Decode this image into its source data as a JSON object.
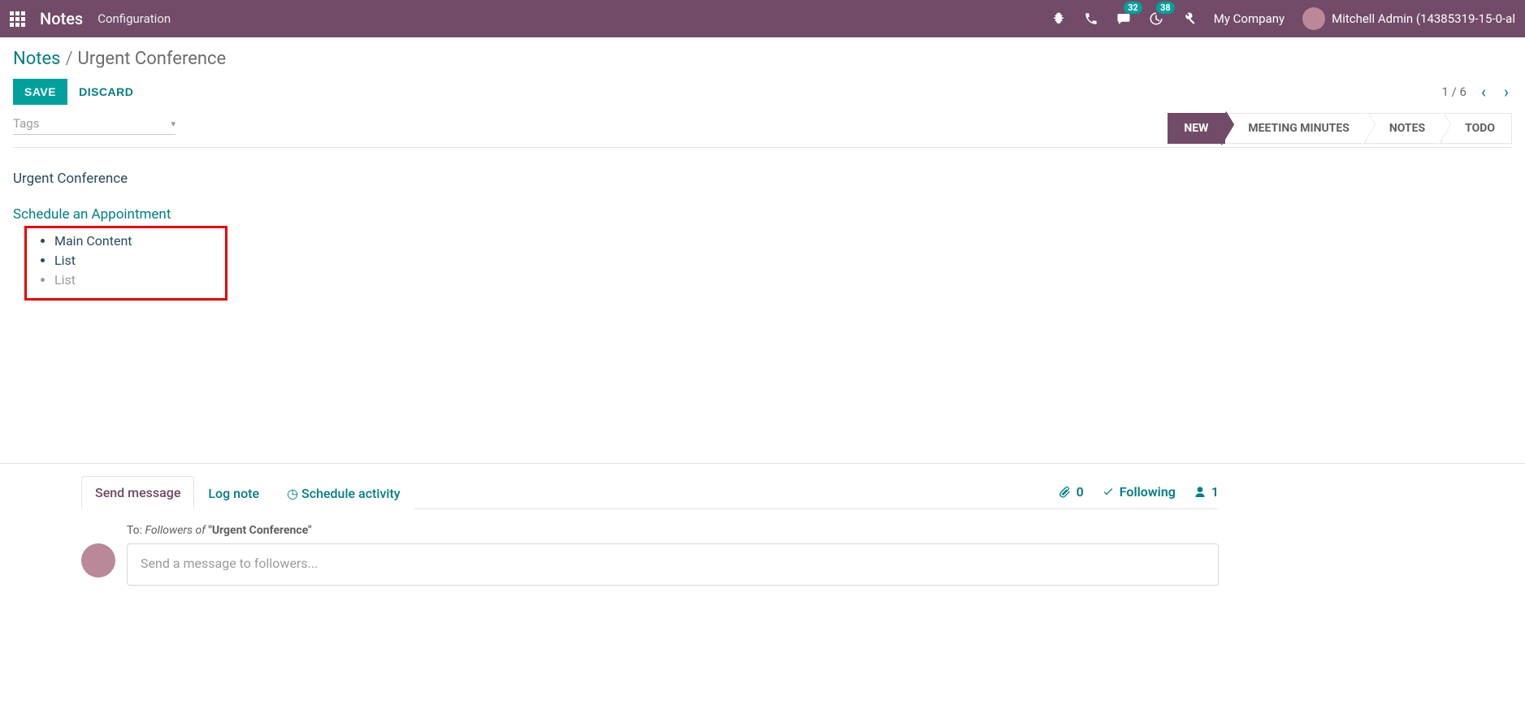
{
  "navbar": {
    "brand": "Notes",
    "menu_item": "Configuration",
    "msg_badge": "32",
    "activity_badge": "38",
    "company": "My Company",
    "user": "Mitchell Admin (14385319-15-0-al"
  },
  "breadcrumb": {
    "root": "Notes",
    "sep": "/",
    "current": "Urgent Conference"
  },
  "actions": {
    "save": "SAVE",
    "discard": "DISCARD"
  },
  "pager": {
    "text": "1 / 6"
  },
  "tags": {
    "placeholder": "Tags"
  },
  "stages": {
    "s1": "NEW",
    "s2": "MEETING MINUTES",
    "s3": "NOTES",
    "s4": "TODO"
  },
  "note": {
    "title": "Urgent Conference",
    "link": "Schedule an Appointment",
    "items": [
      "Main Content",
      "List",
      "List"
    ]
  },
  "chatter": {
    "tab_send": "Send message",
    "tab_log": "Log note",
    "tab_activity": "Schedule activity",
    "attach_count": "0",
    "following": "Following",
    "followers_count": "1",
    "to_label": "To:",
    "to_followers": "Followers of",
    "to_subject": "\"Urgent Conference\"",
    "placeholder": "Send a message to followers..."
  }
}
